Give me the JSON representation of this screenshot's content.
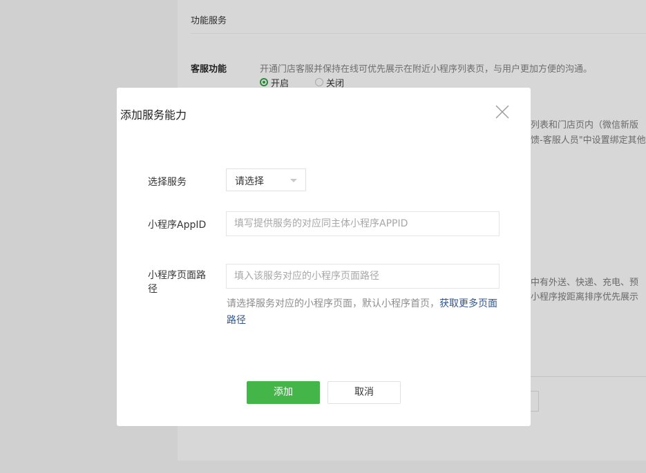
{
  "background": {
    "section_title": "功能服务",
    "kefu": {
      "label": "客服功能",
      "description": "开通门店客服并保持在线可优先展示在附近小程序列表页，与用户更加方便的沟通。",
      "radio_on": "开启",
      "radio_off": "关闭"
    },
    "right_text_1": "列表和门店页内（微信新版",
    "right_text_2": "馈-客服人员\"中设置绑定其他",
    "right_text_3": "中有外送、快递、充电、预",
    "right_text_4": "小程序按距离排序优先展示"
  },
  "modal": {
    "title": "添加服务能力",
    "service_label": "选择服务",
    "service_select_value": "请选择",
    "appid_label": "小程序AppID",
    "appid_placeholder": "填写提供服务的对应同主体小程序APPID",
    "path_label_line1": "小程序页面路",
    "path_label_line2": "径",
    "path_placeholder": "填入该服务对应的小程序页面路径",
    "path_hint": "请选择服务对应的小程序页面，默认小程序首页，",
    "path_hint_link": "获取更多页面路径",
    "add_button": "添加",
    "cancel_button": "取消"
  }
}
